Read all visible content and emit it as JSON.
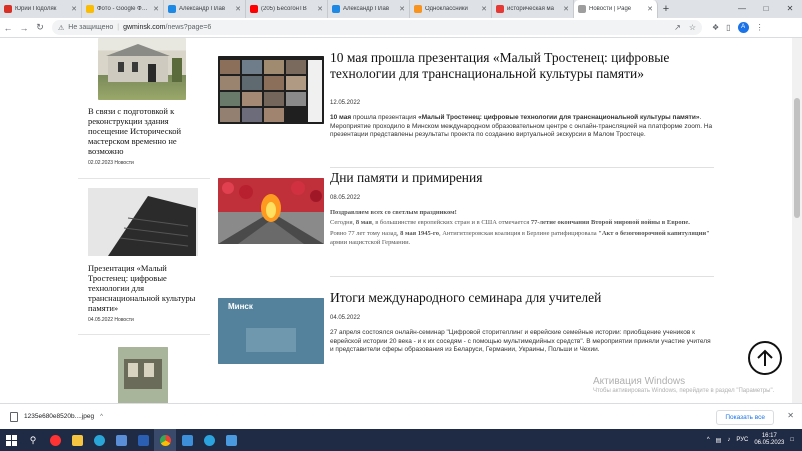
{
  "browser": {
    "tabs": [
      {
        "title": "Юрий Подоляк",
        "color": "#d93025"
      },
      {
        "title": "Фото - Google Фото",
        "color": "#fbbc04"
      },
      {
        "title": "Александр Плав",
        "color": "#1e88e5"
      },
      {
        "title": "(205) БесогонТВ",
        "color": "#ff0000"
      },
      {
        "title": "Александр Плав",
        "color": "#1e88e5"
      },
      {
        "title": "Одноклассники",
        "color": "#f7931e"
      },
      {
        "title": "историческая ма",
        "color": "#e53935"
      },
      {
        "title": "Новости | Page",
        "color": "#9e9e9e"
      }
    ],
    "address": {
      "security": "Не защищено",
      "host": "gwminsk.com",
      "path": "/news?page=6"
    },
    "profile_initial": "A"
  },
  "sidebar": {
    "items": [
      {
        "title": "В связи с подготовкой к реконструкции здания посещение Исторической мастерском временно не возможно",
        "date": "02.02.2023",
        "category": "Новости"
      },
      {
        "title": "Презентация «Малый Тростенец: цифровые технологии для транснациональной культуры памяти»",
        "date": "04.05.2022",
        "category": "Новости"
      }
    ]
  },
  "articles": [
    {
      "title": "10 мая прошла презентация «Малый Тростенец: цифровые технологии для транснациональной культуры памяти»",
      "date": "12.05.2022",
      "body_bold1": "10 мая",
      "body_part1": " прошла презентация ",
      "body_bold2": "«Малый Тростенец: цифровые технологии для транснациональной культуры памяти»",
      "body_part2": ". Мероприятие проходило в Минском международном образовательном центре с онлайн-трансляцией на платформе zoom. На презентации представлены результаты проекта по созданию виртуальной экскурсии в Малом Тростеце."
    },
    {
      "title": "Дни памяти и примирения",
      "date": "08.05.2022",
      "lead": "Поздравляем всех со светлым праздником!",
      "p1_a": "Сегодня, ",
      "p1_b": "8 мая",
      "p1_c": ", в большинстве европейских стран и в США отмечается ",
      "p1_d": "77-летие окончания Второй мировой войны в Европе.",
      "p2_a": "Ровно 77 лет тому назад, ",
      "p2_b": "8 мая 1945-го",
      "p2_c": ", Антигитлеровская коалиция в Берлине ратифицировала ",
      "p2_d": "\"Акт о безоговорочной капитуляции\"",
      "p2_e": " армии нацистской Германии."
    },
    {
      "title": "Итоги международного семинара для учителей",
      "date": "04.05.2022",
      "body": "27 апреля состоялся онлайн-семинар \"Цифровой сторителлинг и еврейские семейные истории: приобщение учеников к еврейской истории 20 века - и к их соседям - с помощью мультимедийных средств\". В мероприятии приняли участие учителя и представители сферы образования из Беларуси, Германии, Украины, Польши и Чехии.",
      "thumb_label": "Минск"
    }
  ],
  "watermark": {
    "title": "Активация Windows",
    "text": "Чтобы активировать Windows, перейдите в раздел \"Параметры\"."
  },
  "downloads": {
    "file": "1235e680e8520b....jpeg",
    "show_all": "Показать все"
  },
  "taskbar": {
    "lang": "РУС",
    "time": "16:17",
    "date": "06.05.2023"
  }
}
